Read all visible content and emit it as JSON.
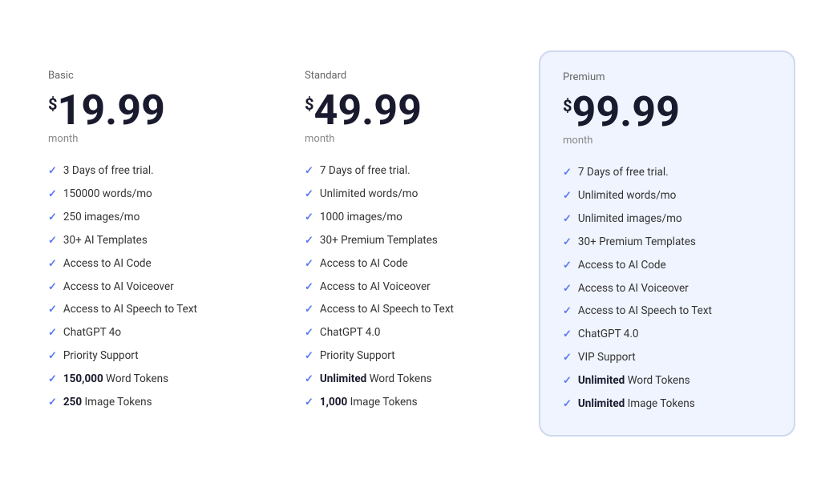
{
  "plans": [
    {
      "id": "basic",
      "name": "Basic",
      "currency": "$",
      "price": "19.99",
      "period": "month",
      "highlighted": false,
      "features": [
        {
          "text": "3 Days of free trial.",
          "bold": false
        },
        {
          "text": "150000 words/mo",
          "bold": false
        },
        {
          "text": "250 images/mo",
          "bold": false
        },
        {
          "text": "30+ AI Templates",
          "bold": false
        },
        {
          "text": "Access to AI Code",
          "bold": false
        },
        {
          "text": "Access to AI Voiceover",
          "bold": false
        },
        {
          "text": "Access to AI Speech to Text",
          "bold": false
        },
        {
          "text": "ChatGPT 4o",
          "bold": false
        },
        {
          "text": "Priority Support",
          "bold": false
        },
        {
          "prefix": "150,000",
          "suffix": " Word Tokens",
          "bold": true
        },
        {
          "prefix": "250",
          "suffix": " Image Tokens",
          "bold": true
        }
      ]
    },
    {
      "id": "standard",
      "name": "Standard",
      "currency": "$",
      "price": "49.99",
      "period": "month",
      "highlighted": false,
      "features": [
        {
          "text": "7 Days of free trial.",
          "bold": false
        },
        {
          "text": "Unlimited words/mo",
          "bold": false
        },
        {
          "text": "1000 images/mo",
          "bold": false
        },
        {
          "text": "30+ Premium Templates",
          "bold": false
        },
        {
          "text": "Access to AI Code",
          "bold": false
        },
        {
          "text": "Access to AI Voiceover",
          "bold": false
        },
        {
          "text": "Access to AI Speech to Text",
          "bold": false
        },
        {
          "text": "ChatGPT 4.0",
          "bold": false
        },
        {
          "text": "Priority Support",
          "bold": false
        },
        {
          "prefix": "Unlimited",
          "suffix": " Word Tokens",
          "bold": true
        },
        {
          "prefix": "1,000",
          "suffix": " Image Tokens",
          "bold": true
        }
      ]
    },
    {
      "id": "premium",
      "name": "Premium",
      "currency": "$",
      "price": "99.99",
      "period": "month",
      "highlighted": true,
      "features": [
        {
          "text": "7 Days of free trial.",
          "bold": false
        },
        {
          "text": "Unlimited words/mo",
          "bold": false
        },
        {
          "text": "Unlimited images/mo",
          "bold": false
        },
        {
          "text": "30+ Premium Templates",
          "bold": false
        },
        {
          "text": "Access to AI Code",
          "bold": false
        },
        {
          "text": "Access to AI Voiceover",
          "bold": false
        },
        {
          "text": "Access to AI Speech to Text",
          "bold": false
        },
        {
          "text": "ChatGPT 4.0",
          "bold": false
        },
        {
          "text": "VIP Support",
          "bold": false
        },
        {
          "prefix": "Unlimited",
          "suffix": " Word Tokens",
          "bold": true
        },
        {
          "prefix": "Unlimited",
          "suffix": " Image Tokens",
          "bold": true
        }
      ]
    }
  ],
  "check_symbol": "✓"
}
